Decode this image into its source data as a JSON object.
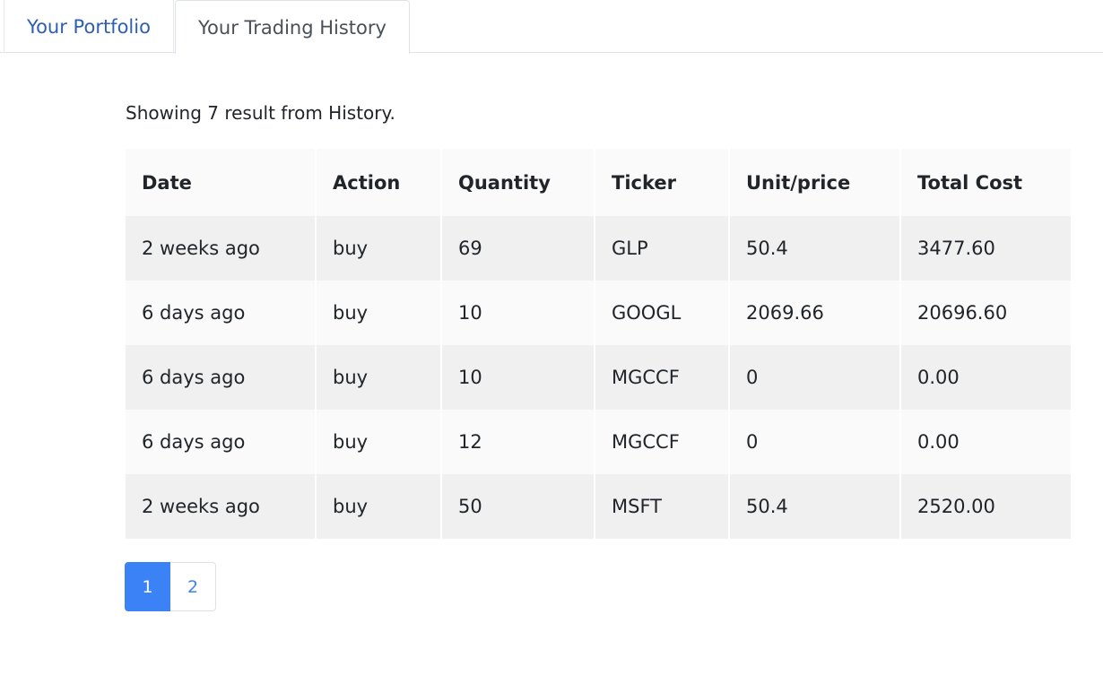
{
  "tabs": {
    "portfolio_label": "Your Portfolio",
    "history_label": "Your Trading History",
    "active": "history"
  },
  "summary_text": "Showing 7 result from History.",
  "table": {
    "headers": [
      "Date",
      "Action",
      "Quantity",
      "Ticker",
      "Unit/price",
      "Total Cost"
    ],
    "rows": [
      [
        "2 weeks ago",
        "buy",
        "69",
        "GLP",
        "50.4",
        "3477.60"
      ],
      [
        "6 days ago",
        "buy",
        "10",
        "GOOGL",
        "2069.66",
        "20696.60"
      ],
      [
        "6 days ago",
        "buy",
        "10",
        "MGCCF",
        "0",
        "0.00"
      ],
      [
        "6 days ago",
        "buy",
        "12",
        "MGCCF",
        "0",
        "0.00"
      ],
      [
        "2 weeks ago",
        "buy",
        "50",
        "MSFT",
        "50.4",
        "2520.00"
      ]
    ]
  },
  "pagination": {
    "pages": [
      "1",
      "2"
    ],
    "current": "1"
  },
  "colors": {
    "link": "#2f5fb3",
    "accent": "#3b82f6",
    "row_odd": "#f0f0f0",
    "row_even": "#fafafa"
  }
}
